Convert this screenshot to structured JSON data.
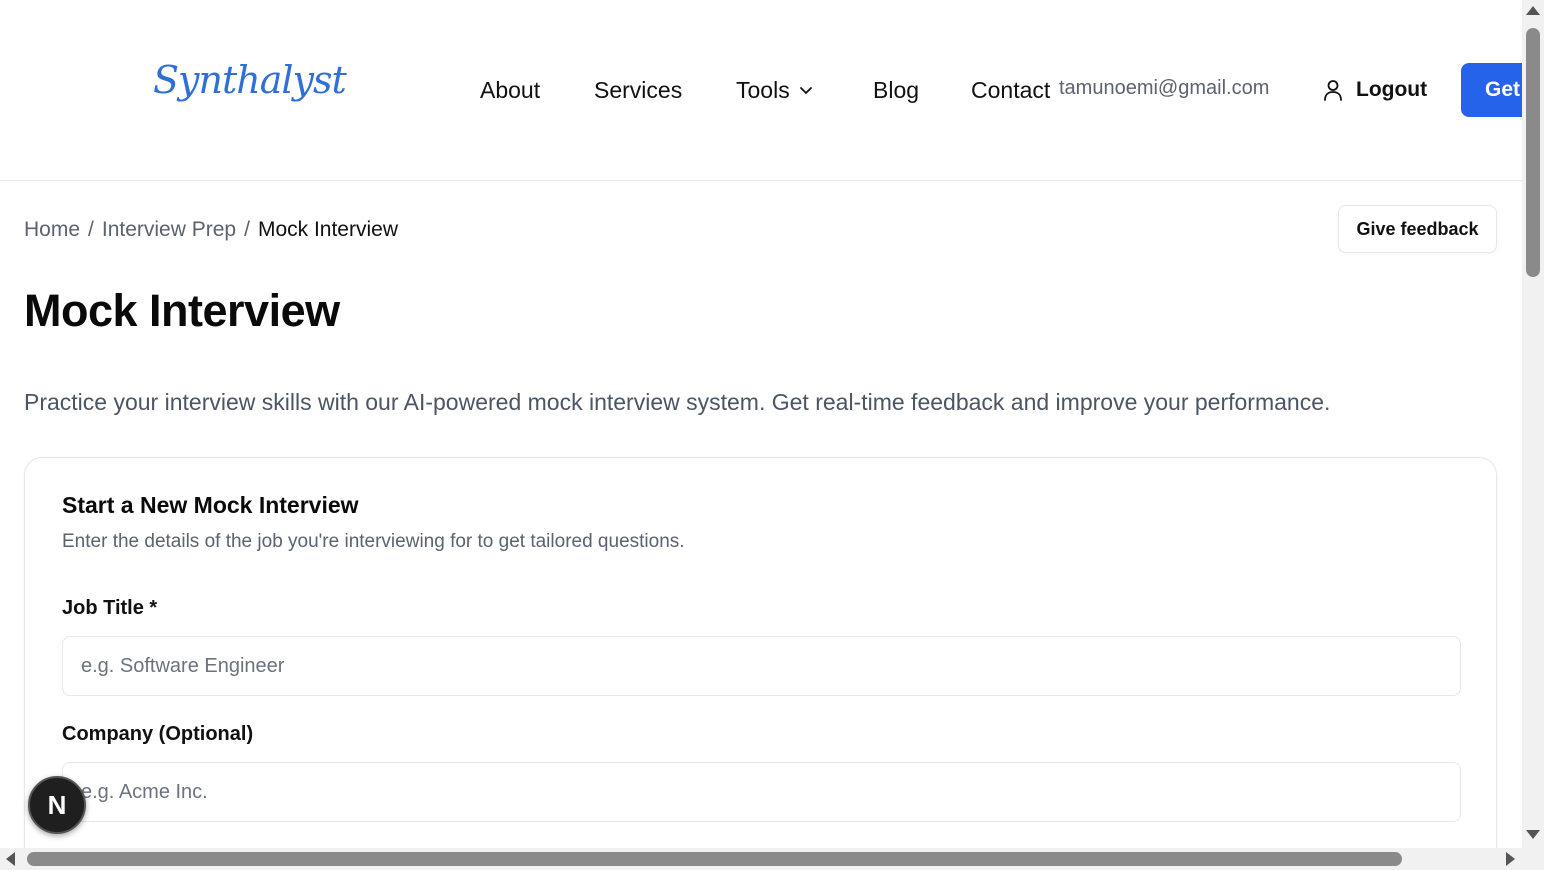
{
  "header": {
    "logo": "Synthalyst",
    "nav": {
      "about": "About",
      "services": "Services",
      "tools": "Tools",
      "blog": "Blog",
      "contact": "Contact"
    },
    "user_email": "tamunoemi@gmail.com",
    "logout_label": "Logout",
    "cta_label": "Get"
  },
  "breadcrumb": {
    "home": "Home",
    "separator": "/",
    "interview_prep": "Interview Prep",
    "current": "Mock Interview"
  },
  "feedback_button": "Give feedback",
  "page": {
    "title": "Mock Interview",
    "description": "Practice your interview skills with our AI-powered mock interview system. Get real-time feedback and improve your performance."
  },
  "form": {
    "title": "Start a New Mock Interview",
    "subtitle": "Enter the details of the job you're interviewing for to get tailored questions.",
    "job_title": {
      "label": "Job Title *",
      "placeholder": "e.g. Software Engineer",
      "value": ""
    },
    "company": {
      "label": "Company (Optional)",
      "placeholder": "e.g. Acme Inc.",
      "value": ""
    }
  },
  "dev_badge": "N",
  "colors": {
    "brand_blue": "#2563eb",
    "logo_blue": "#2f6fd6",
    "muted_text": "#5b6270",
    "border": "#e5e7eb"
  },
  "icons": [
    "chevron-down-icon",
    "user-icon"
  ]
}
